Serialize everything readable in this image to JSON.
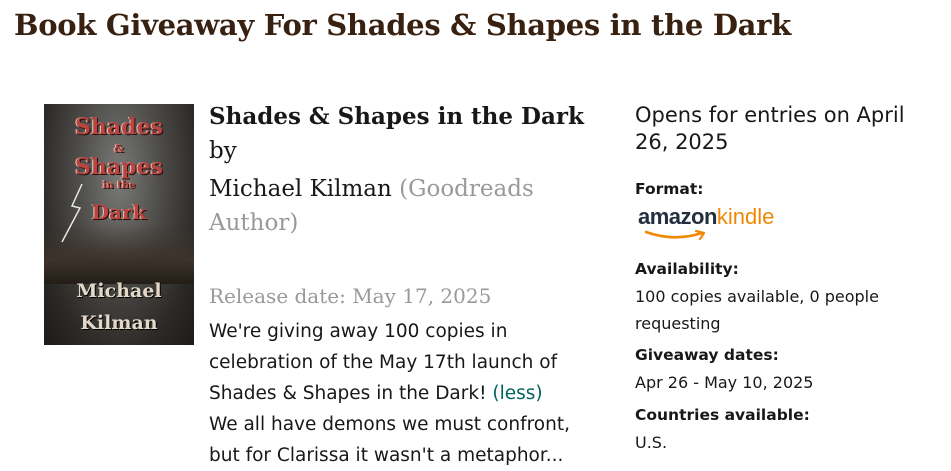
{
  "header": {
    "title": "Book Giveaway For Shades & Shapes in the Dark"
  },
  "cover": {
    "title_line1": "Shades",
    "title_amp": "&",
    "title_line2": "Shapes",
    "title_in_the": "in the",
    "title_line3": "Dark",
    "author_first": "Michael",
    "author_last": "Kilman"
  },
  "book": {
    "title": "Shades & Shapes in the Dark",
    "by": "by",
    "author_name": "Michael Kilman",
    "author_role": "(Goodreads Author)",
    "release": "Release date: May 17, 2025",
    "description_part1": "We're giving away 100 copies in celebration of the May 17th launch of Shades & Shapes in the Dark!",
    "less_link": "(less)",
    "description_part2": "We all have demons we must confront, but for Clarissa it wasn't a metaphor..."
  },
  "details": {
    "opens": "Opens for entries on April 26, 2025",
    "format_label": "Format:",
    "format_logo_amazon": "amazon",
    "format_logo_kindle": "kindle",
    "availability_label": "Availability:",
    "availability_value": "100 copies available, 0 people requesting",
    "dates_label": "Giveaway dates:",
    "dates_value": "Apr 26 - May 10, 2025",
    "countries_label": "Countries available:",
    "countries_value": "U.S."
  }
}
